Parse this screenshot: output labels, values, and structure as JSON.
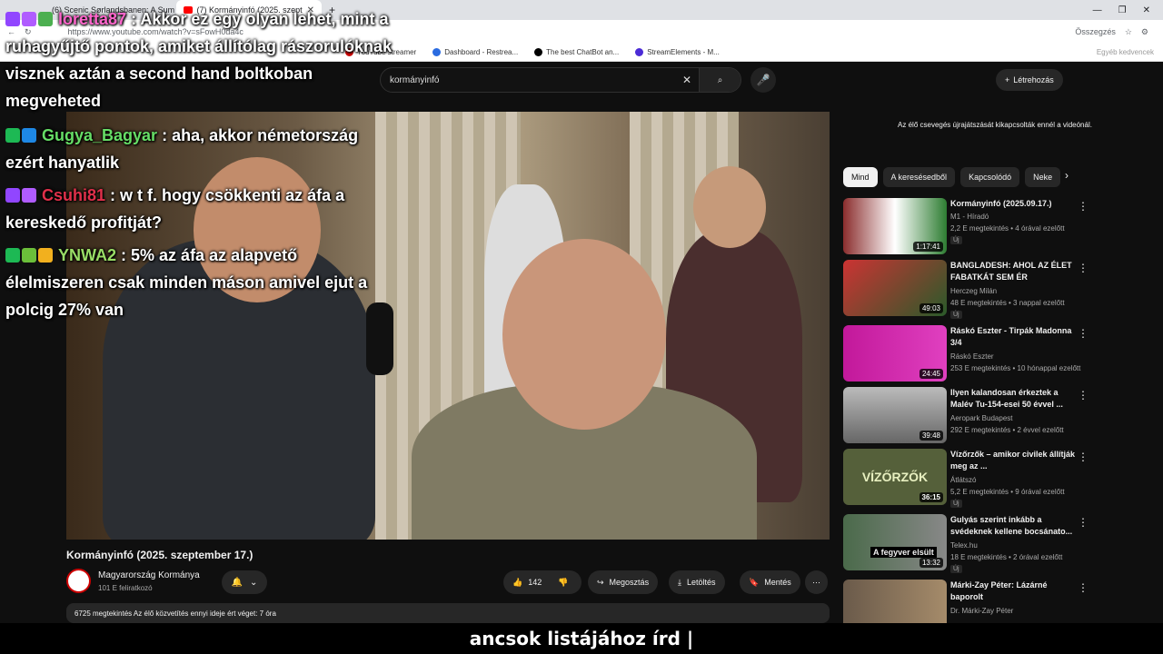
{
  "browser": {
    "tabs": [
      {
        "label": "(6) Scenic Sørlandsbanen: A Sum"
      },
      {
        "label": "(7) Kormányinfó (2025. szept"
      }
    ],
    "url": "https://www.youtube.com/watch?v=sFowH0da4c",
    "summary_label": "Összegzés",
    "bookmarks": [
      "YouTube streamer",
      "Dashboard - Restrea...",
      "The best ChatBot an...",
      "StreamElements - M..."
    ],
    "other_bookmarks": "Egyéb kedvencek"
  },
  "youtube": {
    "search_value": "kormányinfó",
    "create_label": "Létrehozás",
    "video_title": "Kormányinfó (2025. szeptember 17.)",
    "channel_name": "Magyarország Kormánya",
    "subscribers": "101 E feliratkozó",
    "likes": "142",
    "share_label": "Megosztás",
    "download_label": "Letöltés",
    "save_label": "Mentés",
    "description": "6725 megtekintés  Az élő közvetítés ennyi ideje ért véget: 7 óra",
    "chat_disabled": "Az élő csevegés újrajátszását kikapcsolták ennél a videónál.",
    "chips": [
      "Mind",
      "A keresésedből",
      "Kapcsolódó",
      "Neke"
    ]
  },
  "recommendations": [
    {
      "title": "Kormányinfó (2025.09.17.)",
      "channel": "M1 - Híradó",
      "meta": "2,2 E megtekintés • 4 órával ezelőtt",
      "badge": "Új",
      "duration": "1:17:41",
      "color": "#8a2d2d"
    },
    {
      "title": "BANGLADESH: AHOL AZ ÉLET FABATKÁT SEM ÉR",
      "channel": "Herczeg Milán",
      "meta": "48 E megtekintés • 3 nappal ezelőtt",
      "badge": "Új",
      "duration": "49:03",
      "color": "#a33"
    },
    {
      "title": "Ráskó Eszter - Tirpák Madonna 3/4",
      "channel": "Ráskó Eszter",
      "meta": "253 E megtekintés • 10 hónappal ezelőtt",
      "badge": "",
      "duration": "24:45",
      "color": "#c2189a"
    },
    {
      "title": "Ilyen kalandosan érkeztek a Malév Tu-154-esei 50 évvel ...",
      "channel": "Aeropark Budapest",
      "meta": "292 E megtekintés • 2 évvel ezelőtt",
      "badge": "",
      "duration": "39:48",
      "color": "#777"
    },
    {
      "title": "Vízőrzők – amikor civilek állítják meg az ...",
      "channel": "Átlátszó",
      "meta": "5,2 E megtekintés • 9 órával ezelőtt",
      "badge": "Új",
      "duration": "36:15",
      "color": "#55603a",
      "thumb_text": "VÍZŐRZŐK"
    },
    {
      "title": "Gulyás szerint inkább a svédeknek kellene bocsánato...",
      "channel": "Telex.hu",
      "meta": "18 E megtekintés • 2 órával ezelőtt",
      "badge": "Új",
      "duration": "13:32",
      "color": "#4a6a4a",
      "thumb_text": "A fegyver elsült"
    },
    {
      "title": "Márki-Zay Péter: Lázárné baporolt",
      "channel": "Dr. Márki-Zay Péter",
      "meta": "",
      "badge": "",
      "duration": "",
      "color": "#6a5a4a"
    }
  ],
  "chat": [
    {
      "user": "loretta87",
      "user_color": "#ff66cc",
      "text": ": Akkor ez egy olyan lehet, mint a ruhagyűjtő pontok, amiket állítólag rászorulóknak visznek aztán a second hand boltkoban megveheted"
    },
    {
      "user": "Gugya_Bagyar",
      "user_color": "#66dd66",
      "text": ": aha, akkor németország ezért hanyatlik"
    },
    {
      "user": "Csuhi81",
      "user_color": "#e0304a",
      "text": ": w t f. hogy csökkenti az áfa a kereskedő profitját?"
    },
    {
      "user": "YNWA2",
      "user_color": "#99dd66",
      "text": ": 5% az áfa az alapvető élelmiszeren csak minden máson amivel ejut a polcig 27% van"
    }
  ],
  "caption": "ancsok listájához írd |"
}
